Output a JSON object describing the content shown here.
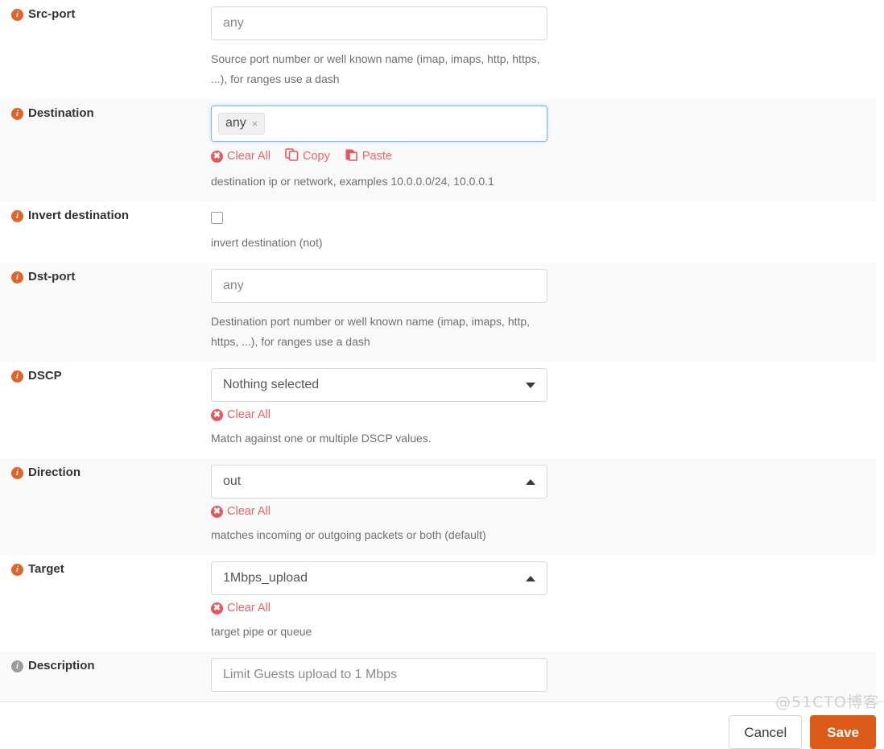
{
  "form": {
    "rows": [
      {
        "id": "src-port",
        "label": "Src-port",
        "icon": "info-icon",
        "icon_color": "#e0642a",
        "control": "text",
        "value": "any",
        "placeholder": "any",
        "help": "Source port number or well known name (imap, imaps, http, https, ...), for ranges use a dash"
      },
      {
        "id": "destination",
        "label": "Destination",
        "icon": "info-icon",
        "icon_color": "#e0642a",
        "control": "tokens",
        "tokens": [
          "any"
        ],
        "links": [
          "Clear All",
          "Copy",
          "Paste"
        ],
        "help": "destination ip or network, examples 10.0.0.0/24, 10.0.0.1"
      },
      {
        "id": "invert-destination",
        "label": "Invert destination",
        "icon": "info-icon",
        "icon_color": "#e0642a",
        "control": "checkbox",
        "checked": false,
        "help": "invert destination (not)"
      },
      {
        "id": "dst-port",
        "label": "Dst-port",
        "icon": "info-icon",
        "icon_color": "#e0642a",
        "control": "text",
        "value": "any",
        "placeholder": "any",
        "help": "Destination port number or well known name (imap, imaps, http, https, ...), for ranges use a dash"
      },
      {
        "id": "dscp",
        "label": "DSCP",
        "icon": "info-icon",
        "icon_color": "#e0642a",
        "control": "select",
        "value": "Nothing selected",
        "caret": "down",
        "links": [
          "Clear All"
        ],
        "help": "Match against one or multiple DSCP values."
      },
      {
        "id": "direction",
        "label": "Direction",
        "icon": "info-icon",
        "icon_color": "#e0642a",
        "control": "select",
        "value": "out",
        "caret": "up",
        "links": [
          "Clear All"
        ],
        "help": "matches incoming or outgoing packets or both (default)"
      },
      {
        "id": "target",
        "label": "Target",
        "icon": "info-icon",
        "icon_color": "#e0642a",
        "control": "select",
        "value": "1Mbps_upload",
        "caret": "up",
        "links": [
          "Clear All"
        ],
        "help": "target pipe or queue"
      },
      {
        "id": "description",
        "label": "Description",
        "icon": "info-icon",
        "icon_color": "#9b9b9b",
        "control": "text",
        "value": "Limit Guests upload to 1 Mbps",
        "placeholder": "Description",
        "help": ""
      }
    ]
  },
  "footer": {
    "cancel_label": "Cancel",
    "save_label": "Save",
    "save_color": "#dd5b18"
  },
  "watermark": {
    "text": "@51CTO博客"
  },
  "icons": {
    "info": "i",
    "clear": "✖",
    "token_remove": "×"
  }
}
